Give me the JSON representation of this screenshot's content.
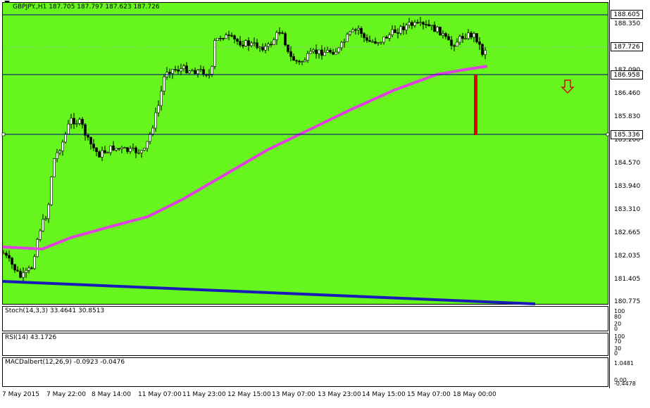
{
  "header": {
    "title": "GBPJPY.,H1  187.705 187.797 187.623 187.726"
  },
  "price_axis": [
    "188.350",
    "187.090",
    "186.460",
    "185.830",
    "185.200",
    "184.570",
    "183.940",
    "183.310",
    "182.665",
    "182.035",
    "181.405",
    "180.775"
  ],
  "price_tags": {
    "top_line": "188.605",
    "current": "187.726",
    "line_mid": "186.958",
    "line_low": "185.336"
  },
  "stoch": {
    "label": "Stoch(14,3,3) 33.4641 30.8513",
    "axis": [
      "100",
      "80",
      "20",
      "0"
    ]
  },
  "rsi": {
    "label": "RSI(14) 43.1726",
    "axis": [
      "100",
      "70",
      "30",
      "0"
    ]
  },
  "macd": {
    "label": "MACDalbert(12,26,9) -0.0923 -0.0476",
    "axis": [
      "1.0481",
      "0.00",
      "-0.4478"
    ]
  },
  "dates": [
    "7 May 2015",
    "7 May 22:00",
    "8 May 14:00",
    "11 May 07:00",
    "11 May 23:00",
    "12 May 15:00",
    "13 May 07:00",
    "13 May 23:00",
    "14 May 15:00",
    "15 May 07:00",
    "18 May 00:00"
  ],
  "colors": {
    "chart_bg": "#66f51c",
    "ma": "#e040e0",
    "trend": "#1a1ab8",
    "signal_bar": "#e00000",
    "arrow": "#d01010"
  },
  "arrow_icon": "down-arrow-icon"
}
